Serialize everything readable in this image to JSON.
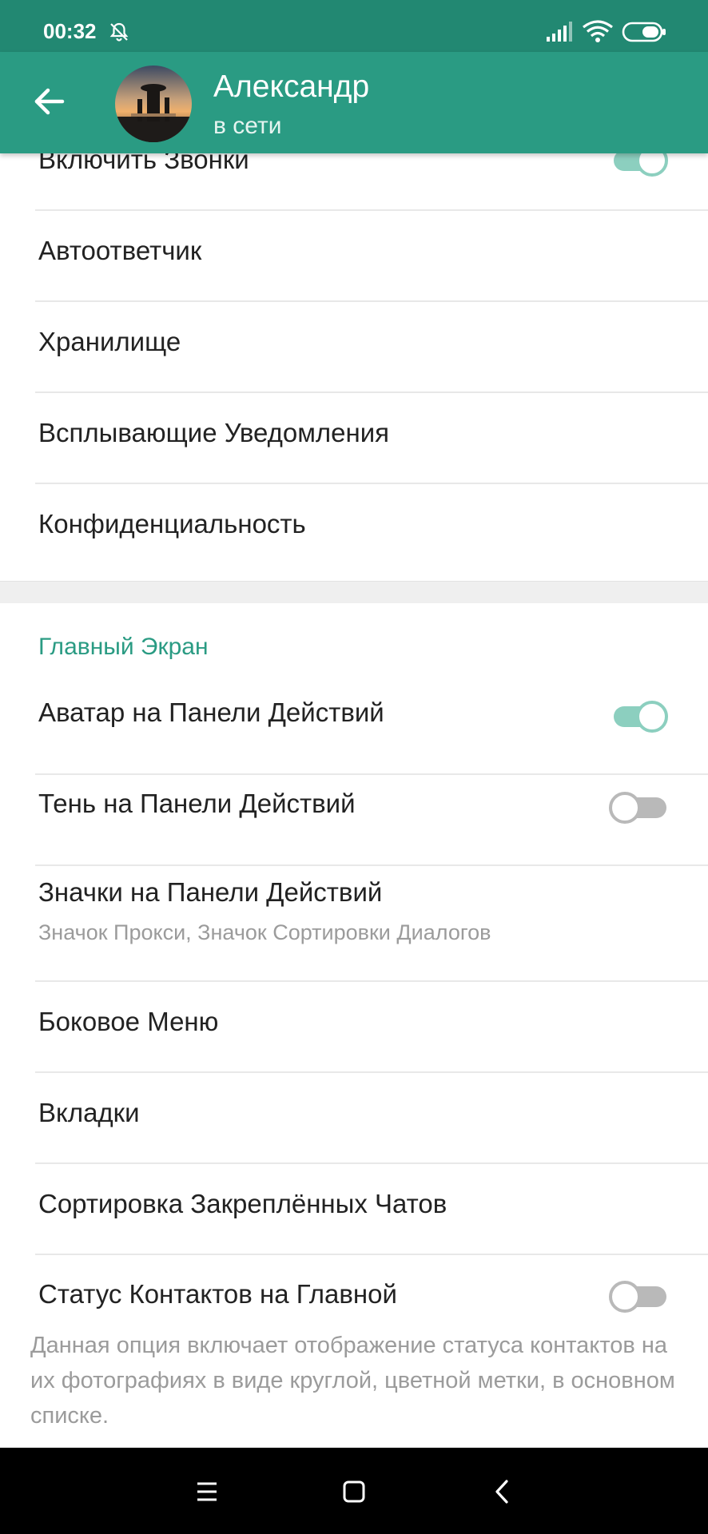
{
  "status_bar": {
    "time": "00:32",
    "icons": [
      "bell-off-icon",
      "signal-icon",
      "wifi-icon",
      "battery-icon"
    ]
  },
  "app_bar": {
    "title": "Александр",
    "subtitle": "в сети",
    "back_icon": "arrow-back-icon"
  },
  "settings_top": [
    {
      "label": "Включить Звонки",
      "toggle": true
    },
    {
      "label": "Автоответчик"
    },
    {
      "label": "Хранилище"
    },
    {
      "label": "Всплывающие Уведомления"
    },
    {
      "label": "Конфиденциальность"
    }
  ],
  "main_screen": {
    "section_title": "Главный Экран",
    "items": [
      {
        "label": "Аватар на Панели Действий",
        "toggle": true
      },
      {
        "label": "Тень на Панели Действий",
        "toggle": false
      },
      {
        "label": "Значки на Панели Действий",
        "sub": "Значок Прокси, Значок Сортировки Диалогов"
      },
      {
        "label": "Боковое Меню"
      },
      {
        "label": "Вкладки"
      },
      {
        "label": "Сортировка Закреплённых Чатов"
      },
      {
        "label": "Статус Контактов на Главной",
        "toggle": false
      }
    ],
    "note": "Данная опция включает отображение статуса контактов на их фотографиях в виде круглой, цветной метки, в основном списке."
  },
  "nav_bar": {
    "buttons": [
      "menu-icon",
      "home-square-icon",
      "back-chevron-icon"
    ]
  },
  "colors": {
    "status_bar": "#228872",
    "app_bar": "#2a9b83",
    "accent": "#2a9b83",
    "switch_on": "#8ccfbf",
    "switch_off": "#b9b9b9"
  }
}
